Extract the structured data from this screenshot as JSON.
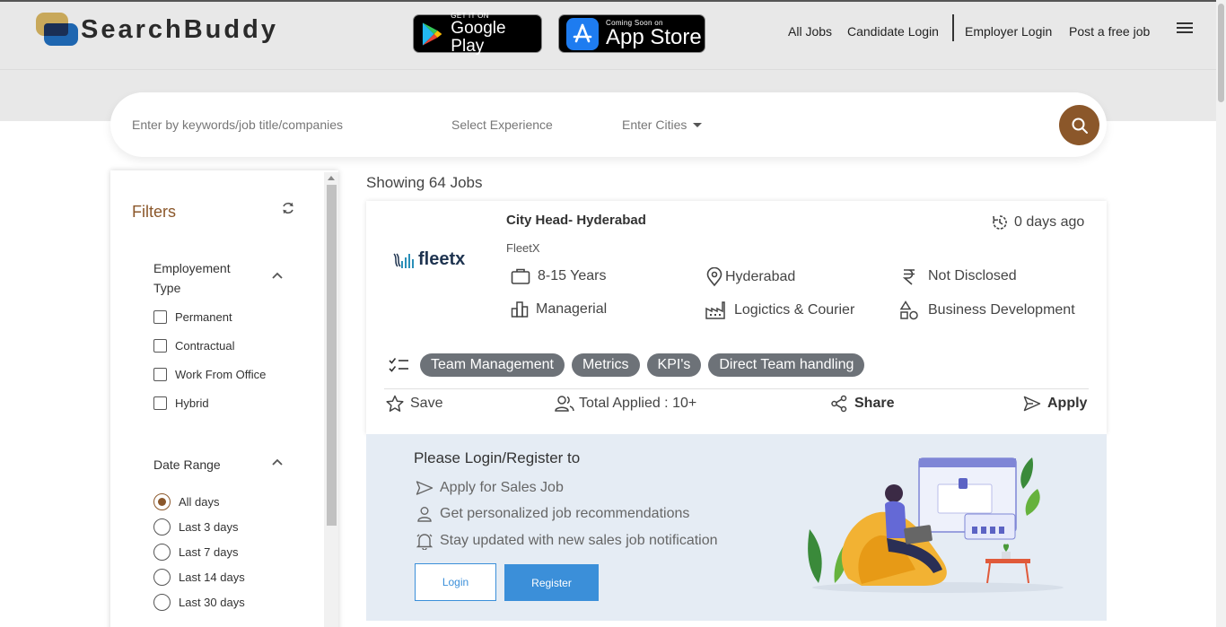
{
  "header": {
    "brand": "SearchBuddy",
    "google_play": {
      "small": "GET IT ON",
      "big": "Google Play"
    },
    "app_store": {
      "small": "Coming Soon on",
      "big": "App Store"
    },
    "nav": {
      "all_jobs": "All Jobs",
      "candidate_login": "Candidate Login",
      "employer_login": "Employer Login",
      "post_job": "Post a free job"
    }
  },
  "search": {
    "keywords_placeholder": "Enter by keywords/job title/companies",
    "experience_placeholder": "Select Experience",
    "cities_placeholder": "Enter Cities"
  },
  "filters": {
    "title": "Filters",
    "employment_type": {
      "title": "Employement Type",
      "options": [
        "Permanent",
        "Contractual",
        "Work From Office",
        "Hybrid"
      ]
    },
    "date_range": {
      "title": "Date Range",
      "options": [
        "All days",
        "Last 3 days",
        "Last 7 days",
        "Last 14 days",
        "Last 30 days"
      ],
      "selected": "All days"
    }
  },
  "results": {
    "showing": "Showing 64 Jobs"
  },
  "job": {
    "company_logo_text": "fleetx",
    "title": "City Head- Hyderabad",
    "company": "FleetX",
    "posted": "0 days ago",
    "experience": "8-15 Years",
    "location": "Hyderabad",
    "salary": "Not Disclosed",
    "role_level": "Managerial",
    "industry": "Logictics & Courier",
    "department": "Business Development",
    "skills": [
      "Team Management",
      "Metrics",
      "KPI's",
      "Direct Team handling"
    ],
    "actions": {
      "save": "Save",
      "total_applied": "Total Applied : 10+",
      "share": "Share",
      "apply": "Apply"
    }
  },
  "login_panel": {
    "title": "Please Login/Register to",
    "items": [
      "Apply for Sales Job",
      "Get personalized job recommendations",
      "Stay updated with new sales job notification"
    ],
    "login": "Login",
    "register": "Register"
  },
  "colors": {
    "accent": "#8b572a",
    "primary_blue": "#3b8fd9",
    "skill_chip": "#6d7278"
  }
}
